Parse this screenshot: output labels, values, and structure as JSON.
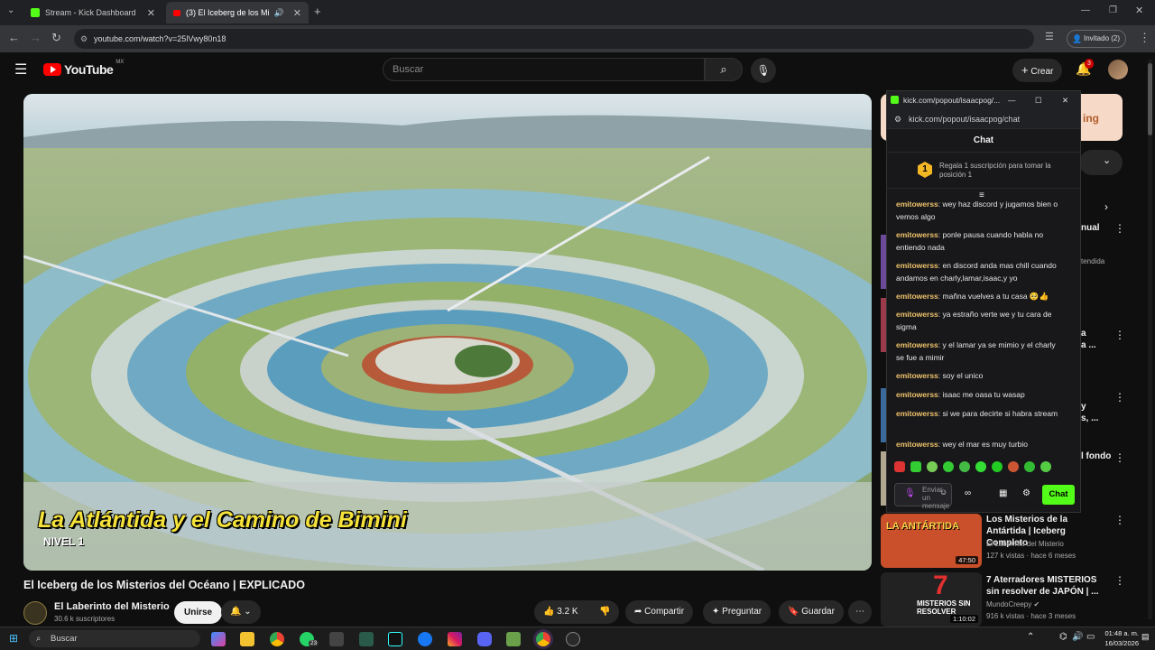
{
  "browser": {
    "tabs": [
      {
        "label": "Stream - Kick Dashboard",
        "active": false
      },
      {
        "label": "(3) El Iceberg de los Misterio",
        "active": true
      }
    ],
    "url": "youtube.com/watch?v=25lVwy80n18",
    "guest_label": "Invitado (2)"
  },
  "youtube": {
    "logo": "YouTube",
    "region": "MX",
    "search_placeholder": "Buscar",
    "create_label": "Crear",
    "notification_count": "3",
    "overlay_text": "La Atlántida y el Camino de Bimini",
    "overlay_level": "NIVEL 1",
    "video_title": "El Iceberg de los Misterios del Océano | EXPLICADO",
    "channel": "El Laberinto del Misterio",
    "subscribers": "30.6 k suscriptores",
    "join_label": "Unirse",
    "likes": "3.2 K",
    "share_label": "Compartir",
    "ask_label": "Preguntar",
    "save_label": "Guardar"
  },
  "recommendations": [
    {
      "title": "Los Misterios de la Antártida | Iceberg Completo",
      "channel": "El Laberinto del Misterio",
      "meta": "127 k vistas · hace 6 meses",
      "duration": "47:50",
      "thumb_text": "LA ANTÁRTIDA",
      "thumb_color": "#c9502a"
    },
    {
      "title": "7 Aterradores MISTERIOS sin resolver de JAPÓN | ...",
      "channel": "MundoCreepy",
      "meta": "916 k vistas · hace 3 meses",
      "duration": "1:10:02",
      "thumb_text": "MISTERIOS SIN RESOLVER",
      "thumb_color": "#222"
    }
  ],
  "partial_right": [
    "nual",
    "tendida",
    "a",
    "a ...",
    "y",
    "s, ...",
    "l fondo",
    "ing"
  ],
  "kick": {
    "window_title": "kick.com/popout/isaacpog/...",
    "url": "kick.com/popout/isaacpog/chat",
    "header": "Chat",
    "pinned_rank": "1",
    "pinned_text": "Regala 1 suscripción para tomar la posición 1",
    "messages": [
      {
        "user": "emitowerss",
        "text": "wey haz discord y jugamos bien o vemos algo"
      },
      {
        "user": "emitowerss",
        "text": "ponle pausa cuando habla no entiendo nada"
      },
      {
        "user": "emitowerss",
        "text": "en discord anda mas chill cuando andamos en charly,lamar,isaac,y yo"
      },
      {
        "user": "emitowerss",
        "text": "mañna vuelves a tu casa 🥺👍"
      },
      {
        "user": "emitowerss",
        "text": "ya estraño verte we y tu cara de sigma"
      },
      {
        "user": "emitowerss",
        "text": "y el lamar ya se mimio y el charly se fue a mimir"
      },
      {
        "user": "emitowerss",
        "text": "soy el unico"
      },
      {
        "user": "emitowerss",
        "text": "isaac me oasa tu wasap"
      },
      {
        "user": "emitowerss",
        "text": "si we para decirte si habra stream"
      },
      {
        "user": "emitowerss",
        "text": "wey el mar es muy turbio"
      }
    ],
    "input_placeholder": "Enviar un mensaje",
    "chat_button": "Chat"
  },
  "taskbar": {
    "search_label": "Buscar",
    "time": "01:48 a. m.",
    "date": "16/03/2026",
    "whatsapp_badge": "23"
  },
  "colors": {
    "kick_green": "#53fc18",
    "yt_red": "#ff0000",
    "chat_user": "#f0c36b"
  }
}
